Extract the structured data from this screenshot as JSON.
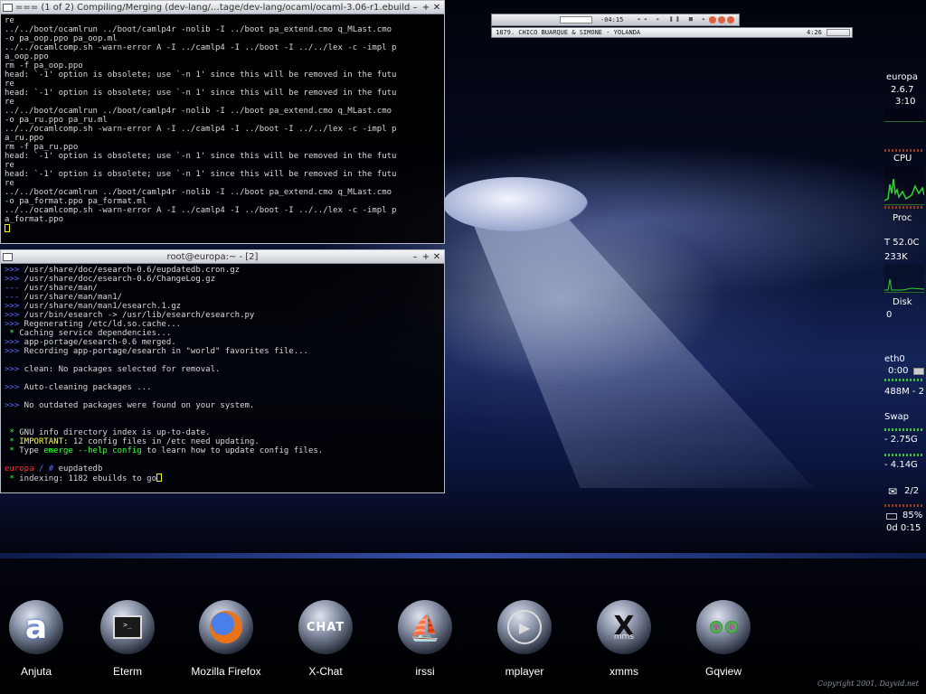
{
  "term1": {
    "title": "=== (1 of 2) Compiling/Merging (dev-lang/…tage/dev-lang/ocaml/ocaml-3.06-r1.ebuild)",
    "lines": [
      "re",
      "../../boot/ocamlrun ../boot/camlp4r -nolib -I ../boot pa_extend.cmo q_MLast.cmo",
      "-o pa_oop.ppo pa_oop.ml",
      "../../ocamlcomp.sh -warn-error A -I ../camlp4 -I ../boot -I ../../lex -c -impl p",
      "a_oop.ppo",
      "rm -f pa_oop.ppo",
      "head: `-1' option is obsolete; use `-n 1' since this will be removed in the futu",
      "re",
      "head: `-1' option is obsolete; use `-n 1' since this will be removed in the futu",
      "re",
      "../../boot/ocamlrun ../boot/camlp4r -nolib -I ../boot pa_extend.cmo q_MLast.cmo",
      "-o pa_ru.ppo pa_ru.ml",
      "../../ocamlcomp.sh -warn-error A -I ../camlp4 -I ../boot -I ../../lex -c -impl p",
      "a_ru.ppo",
      "rm -f pa_ru.ppo",
      "head: `-1' option is obsolete; use `-n 1' since this will be removed in the futu",
      "re",
      "head: `-1' option is obsolete; use `-n 1' since this will be removed in the futu",
      "re",
      "../../boot/ocamlrun ../boot/camlp4r -nolib -I ../boot pa_extend.cmo q_MLast.cmo",
      "-o pa_format.ppo pa_format.ml",
      "../../ocamlcomp.sh -warn-error A -I ../camlp4 -I ../boot -I ../../lex -c -impl p",
      "a_format.ppo"
    ]
  },
  "term2": {
    "title": "root@europa:~ - [2]",
    "lines": [
      ">>> /usr/share/doc/esearch-0.6/eupdatedb.cron.gz",
      ">>> /usr/share/doc/esearch-0.6/ChangeLog.gz",
      "--- /usr/share/man/",
      "--- /usr/share/man/man1/",
      ">>> /usr/share/man/man1/esearch.1.gz",
      ">>> /usr/bin/esearch -> /usr/lib/esearch/esearch.py",
      ">>> Regenerating /etc/ld.so.cache...",
      " * Caching service dependencies...",
      ">>> app-portage/esearch-0.6 merged.",
      ">>> Recording app-portage/esearch in \"world\" favorites file...",
      "",
      ">>> clean: No packages selected for removal.",
      "",
      ">>> Auto-cleaning packages ...",
      "",
      ">>> No outdated packages were found on your system.",
      "",
      "",
      " * GNU info directory index is up-to-date.",
      " * IMPORTANT: 12 config files in /etc need updating.",
      " * Type emerge --help config to learn how to update config files.",
      ""
    ],
    "prompt_host": "europa",
    "prompt_path": " / # ",
    "prompt_cmd": "eupdatedb",
    "last_line": " * indexing: 1182 ebuilds to go"
  },
  "xmms": {
    "time": "-04:15",
    "track": "1879. CHICO BUARQUE & SIMONE - YOLANDA",
    "track_time": "4:26"
  },
  "gkrellm": {
    "host": "europa",
    "kernel": "2.6.7",
    "clock": "3:10",
    "cpu_label": "CPU",
    "proc_label": "Proc",
    "temp": "T 52.0C",
    "mem": "233K",
    "disk_label": "Disk",
    "disk_val": "0",
    "net_label": "eth0",
    "net_time": "0:00",
    "net_total": "488M - 2",
    "swap_label": "Swap",
    "swap_a": "- 2.75G",
    "swap_b": "- 4.14G",
    "mail": "2/2",
    "battery": "85%",
    "uptime": "0d 0:15"
  },
  "dock": [
    {
      "label": "Anjuta"
    },
    {
      "label": "Eterm"
    },
    {
      "label": "Mozilla Firefox"
    },
    {
      "label": "X-Chat"
    },
    {
      "label": "irssi"
    },
    {
      "label": "mplayer"
    },
    {
      "label": "xmms"
    },
    {
      "label": "Gqview"
    }
  ],
  "copyright": "Copyright 2001, Dayvid.net",
  "icons": {
    "anjuta": "anjuta-a-icon",
    "eterm": "terminal-icon",
    "firefox": "firefox-globe-icon",
    "xchat": "chat-x-icon",
    "irssi": "ship-icon",
    "mplayer": "play-icon",
    "xmms": "xmms-x-icon",
    "gqview": "binoculars-icon"
  }
}
